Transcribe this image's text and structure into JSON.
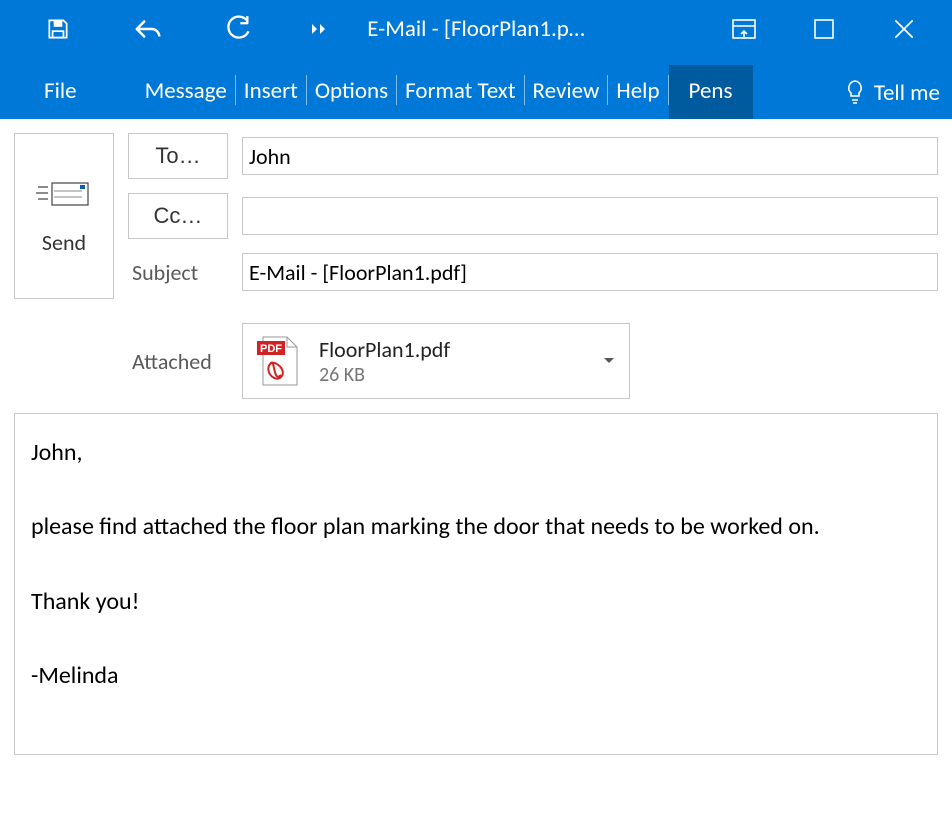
{
  "window": {
    "title": "E-Mail - [FloorPlan1.p…"
  },
  "ribbon": {
    "tabs": [
      "File",
      "Message",
      "Insert",
      "Options",
      "Format Text",
      "Review",
      "Help",
      "Pens"
    ],
    "active_tab": "Pens",
    "tellme": "Tell me"
  },
  "compose": {
    "send_label": "Send",
    "to_label": "To…",
    "to_value": "John",
    "cc_label": "Cc…",
    "cc_value": "",
    "subject_label": "Subject",
    "subject_value": "E-Mail - [FloorPlan1.pdf]",
    "attached_label": "Attached"
  },
  "attachment": {
    "name": "FloorPlan1.pdf",
    "size": "26 KB",
    "badge": "PDF"
  },
  "body": "John,\n\nplease find attached the floor plan marking the door that needs to be worked on.\n\nThank you!\n\n-Melinda"
}
